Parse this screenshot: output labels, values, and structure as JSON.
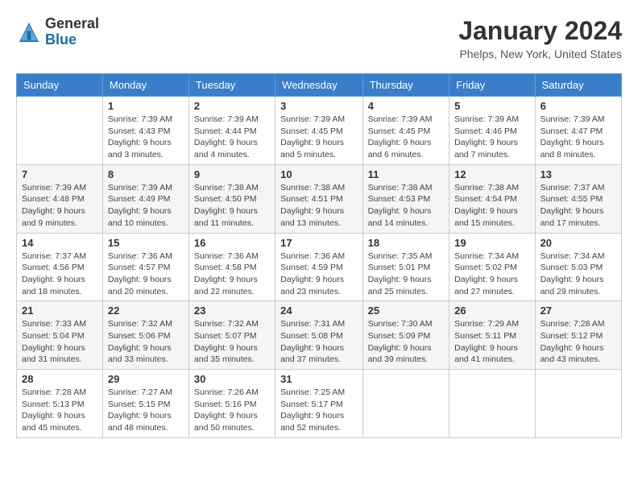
{
  "header": {
    "logo_general": "General",
    "logo_blue": "Blue",
    "month_year": "January 2024",
    "location": "Phelps, New York, United States"
  },
  "calendar": {
    "days_of_week": [
      "Sunday",
      "Monday",
      "Tuesday",
      "Wednesday",
      "Thursday",
      "Friday",
      "Saturday"
    ],
    "weeks": [
      [
        {
          "day": "",
          "info": ""
        },
        {
          "day": "1",
          "info": "Sunrise: 7:39 AM\nSunset: 4:43 PM\nDaylight: 9 hours\nand 3 minutes."
        },
        {
          "day": "2",
          "info": "Sunrise: 7:39 AM\nSunset: 4:44 PM\nDaylight: 9 hours\nand 4 minutes."
        },
        {
          "day": "3",
          "info": "Sunrise: 7:39 AM\nSunset: 4:45 PM\nDaylight: 9 hours\nand 5 minutes."
        },
        {
          "day": "4",
          "info": "Sunrise: 7:39 AM\nSunset: 4:45 PM\nDaylight: 9 hours\nand 6 minutes."
        },
        {
          "day": "5",
          "info": "Sunrise: 7:39 AM\nSunset: 4:46 PM\nDaylight: 9 hours\nand 7 minutes."
        },
        {
          "day": "6",
          "info": "Sunrise: 7:39 AM\nSunset: 4:47 PM\nDaylight: 9 hours\nand 8 minutes."
        }
      ],
      [
        {
          "day": "7",
          "info": "Sunrise: 7:39 AM\nSunset: 4:48 PM\nDaylight: 9 hours\nand 9 minutes."
        },
        {
          "day": "8",
          "info": "Sunrise: 7:39 AM\nSunset: 4:49 PM\nDaylight: 9 hours\nand 10 minutes."
        },
        {
          "day": "9",
          "info": "Sunrise: 7:38 AM\nSunset: 4:50 PM\nDaylight: 9 hours\nand 11 minutes."
        },
        {
          "day": "10",
          "info": "Sunrise: 7:38 AM\nSunset: 4:51 PM\nDaylight: 9 hours\nand 13 minutes."
        },
        {
          "day": "11",
          "info": "Sunrise: 7:38 AM\nSunset: 4:53 PM\nDaylight: 9 hours\nand 14 minutes."
        },
        {
          "day": "12",
          "info": "Sunrise: 7:38 AM\nSunset: 4:54 PM\nDaylight: 9 hours\nand 15 minutes."
        },
        {
          "day": "13",
          "info": "Sunrise: 7:37 AM\nSunset: 4:55 PM\nDaylight: 9 hours\nand 17 minutes."
        }
      ],
      [
        {
          "day": "14",
          "info": "Sunrise: 7:37 AM\nSunset: 4:56 PM\nDaylight: 9 hours\nand 18 minutes."
        },
        {
          "day": "15",
          "info": "Sunrise: 7:36 AM\nSunset: 4:57 PM\nDaylight: 9 hours\nand 20 minutes."
        },
        {
          "day": "16",
          "info": "Sunrise: 7:36 AM\nSunset: 4:58 PM\nDaylight: 9 hours\nand 22 minutes."
        },
        {
          "day": "17",
          "info": "Sunrise: 7:36 AM\nSunset: 4:59 PM\nDaylight: 9 hours\nand 23 minutes."
        },
        {
          "day": "18",
          "info": "Sunrise: 7:35 AM\nSunset: 5:01 PM\nDaylight: 9 hours\nand 25 minutes."
        },
        {
          "day": "19",
          "info": "Sunrise: 7:34 AM\nSunset: 5:02 PM\nDaylight: 9 hours\nand 27 minutes."
        },
        {
          "day": "20",
          "info": "Sunrise: 7:34 AM\nSunset: 5:03 PM\nDaylight: 9 hours\nand 29 minutes."
        }
      ],
      [
        {
          "day": "21",
          "info": "Sunrise: 7:33 AM\nSunset: 5:04 PM\nDaylight: 9 hours\nand 31 minutes."
        },
        {
          "day": "22",
          "info": "Sunrise: 7:32 AM\nSunset: 5:06 PM\nDaylight: 9 hours\nand 33 minutes."
        },
        {
          "day": "23",
          "info": "Sunrise: 7:32 AM\nSunset: 5:07 PM\nDaylight: 9 hours\nand 35 minutes."
        },
        {
          "day": "24",
          "info": "Sunrise: 7:31 AM\nSunset: 5:08 PM\nDaylight: 9 hours\nand 37 minutes."
        },
        {
          "day": "25",
          "info": "Sunrise: 7:30 AM\nSunset: 5:09 PM\nDaylight: 9 hours\nand 39 minutes."
        },
        {
          "day": "26",
          "info": "Sunrise: 7:29 AM\nSunset: 5:11 PM\nDaylight: 9 hours\nand 41 minutes."
        },
        {
          "day": "27",
          "info": "Sunrise: 7:28 AM\nSunset: 5:12 PM\nDaylight: 9 hours\nand 43 minutes."
        }
      ],
      [
        {
          "day": "28",
          "info": "Sunrise: 7:28 AM\nSunset: 5:13 PM\nDaylight: 9 hours\nand 45 minutes."
        },
        {
          "day": "29",
          "info": "Sunrise: 7:27 AM\nSunset: 5:15 PM\nDaylight: 9 hours\nand 48 minutes."
        },
        {
          "day": "30",
          "info": "Sunrise: 7:26 AM\nSunset: 5:16 PM\nDaylight: 9 hours\nand 50 minutes."
        },
        {
          "day": "31",
          "info": "Sunrise: 7:25 AM\nSunset: 5:17 PM\nDaylight: 9 hours\nand 52 minutes."
        },
        {
          "day": "",
          "info": ""
        },
        {
          "day": "",
          "info": ""
        },
        {
          "day": "",
          "info": ""
        }
      ]
    ]
  }
}
